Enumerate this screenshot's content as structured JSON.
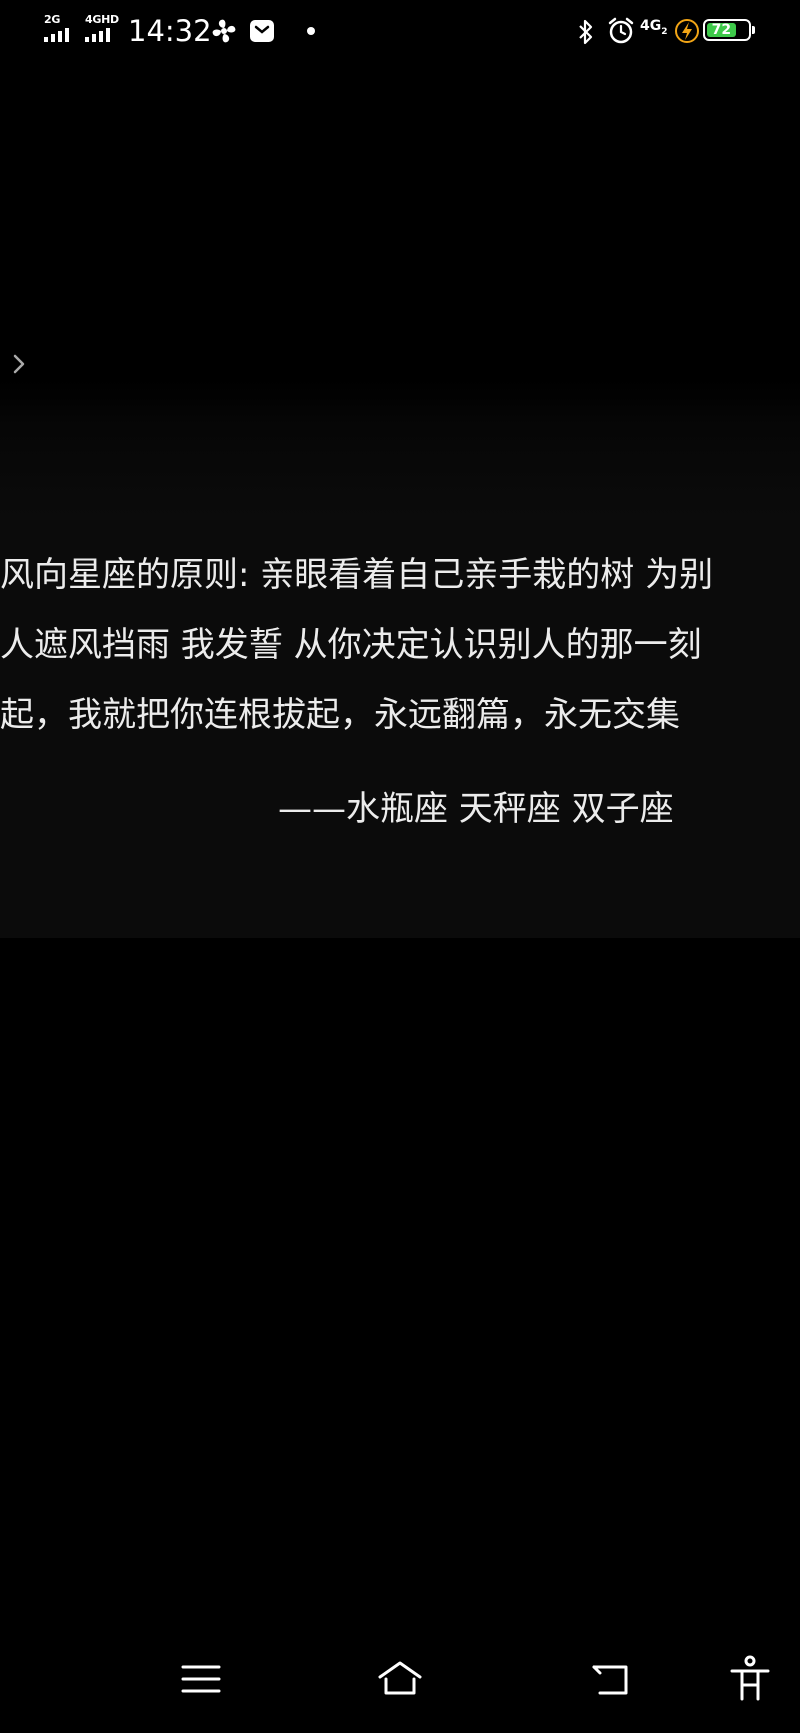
{
  "status_bar": {
    "sim1_label": "2G",
    "sim2_label": "4GHD",
    "time": "14:32",
    "network_label": "4G",
    "network_sub": "2",
    "battery_level": "72",
    "battery_color": "#3ec94a",
    "icons": [
      "fan-icon",
      "message-icon",
      "notification-dot",
      "bluetooth-icon",
      "alarm-icon",
      "charging-icon"
    ]
  },
  "content": {
    "quote_lines": [
      "风向星座的原则: 亲眼看着自己亲手栽的树 为别",
      "人遮风挡雨 我发誓 从你决定认识别人的那一刻",
      "起，我就把你连根拔起，永远翻篇，永无交集"
    ],
    "signature": "——水瓶座 天秤座 双子座"
  },
  "nav_bar": {
    "buttons": [
      "menu-icon",
      "home-icon",
      "back-icon",
      "accessibility-icon"
    ]
  }
}
